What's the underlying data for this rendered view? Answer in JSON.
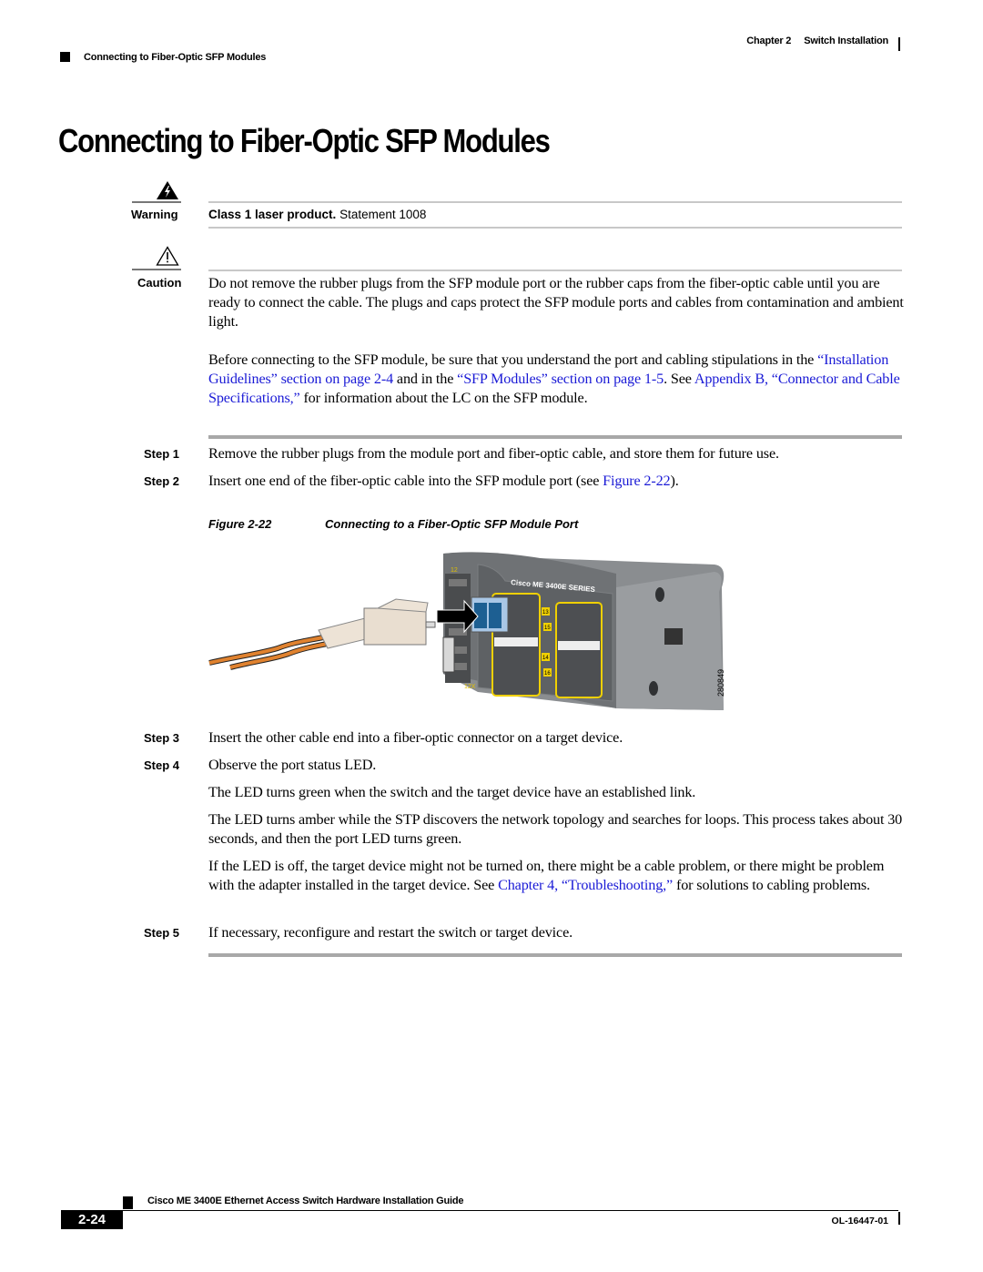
{
  "header": {
    "chapter_label": "Chapter 2",
    "chapter_title": "Switch Installation",
    "section": "Connecting to Fiber-Optic SFP Modules"
  },
  "page_title": "Connecting to Fiber-Optic SFP Modules",
  "warning": {
    "label": "Warning",
    "bold_text": "Class 1 laser product.",
    "text": " Statement 1008",
    "icon": "warning-lightning-icon"
  },
  "caution": {
    "label": "Caution",
    "icon": "caution-triangle-icon",
    "paragraph1": "Do not remove the rubber plugs from the SFP module port or the rubber caps from the fiber-optic cable until you are ready to connect the cable. The plugs and caps protect the SFP module ports and cables from contamination and ambient light.",
    "paragraph2": {
      "t1": "Before connecting to the SFP module, be sure that you understand the port and cabling stipulations in the ",
      "link1": "“Installation Guidelines” section on page 2-4",
      "t2": " and in the ",
      "link2": "“SFP Modules” section on page 1-5",
      "t3": ". See ",
      "link3": "Appendix B, “Connector and Cable Specifications,”",
      "t4": " for information about the LC on the SFP module."
    }
  },
  "steps": [
    {
      "label": "Step 1",
      "text": "Remove the rubber plugs from the module port and fiber-optic cable, and store them for future use."
    },
    {
      "label": "Step 2",
      "text_before": "Insert one end of the fiber-optic cable into the SFP module port (see ",
      "link": "Figure 2-22",
      "text_after": ")."
    },
    {
      "label": "Step 3",
      "text": "Insert the other cable end into a fiber-optic connector on a target device."
    },
    {
      "label": "Step 4",
      "text": "Observe the port status LED.",
      "notes": [
        "The LED turns green when the switch and the target device have an established link.",
        "The LED turns amber while the STP discovers the network topology and searches for loops. This process takes about 30 seconds, and then the port LED turns green."
      ],
      "note3": {
        "t1": "If the LED is off, the target device might not be turned on, there might be a cable problem, or there might be problem with the adapter installed in the target device. See ",
        "link": "Chapter 4, “Troubleshooting,”",
        "t2": " for solutions to cabling problems."
      }
    },
    {
      "label": "Step 5",
      "text": "If necessary, reconfigure and restart the switch or target device."
    }
  ],
  "figure": {
    "number": "Figure 2-22",
    "title": "Connecting to a Fiber-Optic SFP Module Port",
    "device_brand": "Cisco ME 3400E",
    "device_series": "SERIES",
    "port_labels": [
      "12",
      "12X",
      "13",
      "14",
      "15",
      "16"
    ],
    "figure_id": "280849"
  },
  "footer": {
    "guide_title": "Cisco ME 3400E Ethernet Access Switch Hardware Installation Guide",
    "page_number": "2-24",
    "doc_number": "OL-16447-01"
  }
}
